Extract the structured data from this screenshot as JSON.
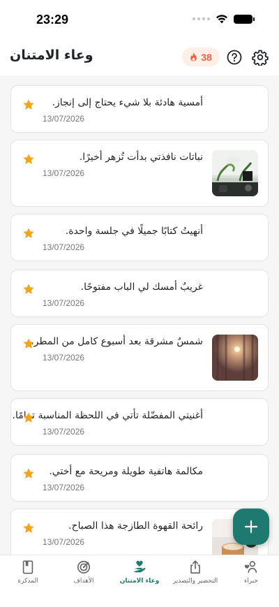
{
  "status_bar": {
    "time": "23:29"
  },
  "header": {
    "title": "وعاء الامتنان",
    "streak_count": "38",
    "icons": [
      "flame-icon",
      "help-icon",
      "settings-gear-icon"
    ]
  },
  "entries": [
    {
      "text": "أمسية هادئة بلا شيء يحتاج إلى إنجاز.",
      "date": "13/07/2026",
      "starred": true,
      "thumbnail": null
    },
    {
      "text": "نباتات نافذتي بدأت تُزهر أخيرًا.",
      "date": "13/07/2026",
      "starred": true,
      "thumbnail": "plants-photo"
    },
    {
      "text": "أنهيتُ كتابًا جميلًا في جلسة واحدة.",
      "date": "13/07/2026",
      "starred": true,
      "thumbnail": null
    },
    {
      "text": "غريبٌ أمسك لي الباب مفتوحًا.",
      "date": "13/07/2026",
      "starred": true,
      "thumbnail": null
    },
    {
      "text": "شمسٌ مشرقة بعد أسبوع كامل من المطر.",
      "date": "13/07/2026",
      "starred": true,
      "thumbnail": "sunlight-curtain-photo"
    },
    {
      "text": "أغنيتي المفضّلة تأتي في اللحظة المناسبة تمامًا.",
      "date": "13/07/2026",
      "starred": true,
      "thumbnail": null
    },
    {
      "text": "مكالمة هاتفية طويلة ومريحة مع أختي.",
      "date": "13/07/2026",
      "starred": true,
      "thumbnail": null
    },
    {
      "text": "رائحة القهوة الطازجة هذا الصباح.",
      "date": "13/07/2026",
      "starred": true,
      "thumbnail": "coffee-photo"
    }
  ],
  "fab": {
    "icon": "plus-icon"
  },
  "bottom_nav": [
    {
      "label": "المذكرة",
      "icon": "journal-book-icon",
      "active": false
    },
    {
      "label": "الأهداف",
      "icon": "target-icon",
      "active": false
    },
    {
      "label": "وعاء الامتنان",
      "icon": "hand-heart-icon",
      "active": true
    },
    {
      "label": "التحضير والتصدير",
      "icon": "share-export-icon",
      "active": false
    },
    {
      "label": "خبراء",
      "icon": "experts-person-heart-icon",
      "active": false
    }
  ],
  "colors": {
    "accent": "#1e7a70",
    "star": "#f2a516",
    "streak_bg": "#fdeee8",
    "streak_text": "#e8643b"
  }
}
